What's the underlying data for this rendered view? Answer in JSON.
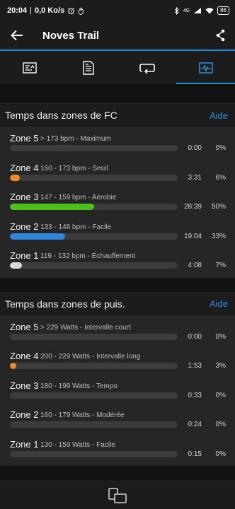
{
  "status": {
    "time": "20:04",
    "speed": "0,0 Ko/s",
    "network": "4G",
    "battery": "86"
  },
  "header": {
    "title": "Noves Trail"
  },
  "tabs": [
    {
      "icon": "summary-card-icon",
      "active": false
    },
    {
      "icon": "document-details-icon",
      "active": false
    },
    {
      "icon": "laps-loop-icon",
      "active": false
    },
    {
      "icon": "activity-graph-icon",
      "active": true
    }
  ],
  "hr_section": {
    "title": "Temps dans zones de FC",
    "help": "Aide",
    "zones": [
      {
        "name": "Zone 5",
        "desc": "> 173 bpm - Maximum",
        "time": "0:00",
        "pct": "0%",
        "fraction": 0.0,
        "color": "#9e9e9e"
      },
      {
        "name": "Zone 4",
        "desc": "160 - 173 bpm - Seuil",
        "time": "3:31",
        "pct": "6%",
        "fraction": 0.06,
        "color": "#f08a24"
      },
      {
        "name": "Zone 3",
        "desc": "147 - 159 bpm - Aérobie",
        "time": "28:39",
        "pct": "50%",
        "fraction": 0.5,
        "color": "#49c21c"
      },
      {
        "name": "Zone 2",
        "desc": "133 - 146 bpm - Facile",
        "time": "19:04",
        "pct": "33%",
        "fraction": 0.33,
        "color": "#2f86dc"
      },
      {
        "name": "Zone 1",
        "desc": "119 - 132 bpm - Échauffement",
        "time": "4:08",
        "pct": "7%",
        "fraction": 0.07,
        "color": "#d9d9d9"
      }
    ]
  },
  "power_section": {
    "title": "Temps dans zones de puis.",
    "help": "Aide",
    "zones": [
      {
        "name": "Zone 5",
        "desc": "> 229 Watts - Intervalle court",
        "time": "0:00",
        "pct": "0%",
        "fraction": 0.0,
        "color": "#f08a24"
      },
      {
        "name": "Zone 4",
        "desc": "200 - 229 Watts - Intervalle long",
        "time": "1:53",
        "pct": "3%",
        "fraction": 0.03,
        "color": "#f08a24"
      },
      {
        "name": "Zone 3",
        "desc": "180 - 199 Watts - Tempo",
        "time": "0:33",
        "pct": "0%",
        "fraction": 0.0,
        "color": "#f08a24"
      },
      {
        "name": "Zone 2",
        "desc": "160 - 179 Watts - Modérée",
        "time": "0:24",
        "pct": "0%",
        "fraction": 0.0,
        "color": "#f08a24"
      },
      {
        "name": "Zone 1",
        "desc": "130 - 159 Watts - Facile",
        "time": "0:15",
        "pct": "0%",
        "fraction": 0.0,
        "color": "#f08a24"
      }
    ]
  }
}
